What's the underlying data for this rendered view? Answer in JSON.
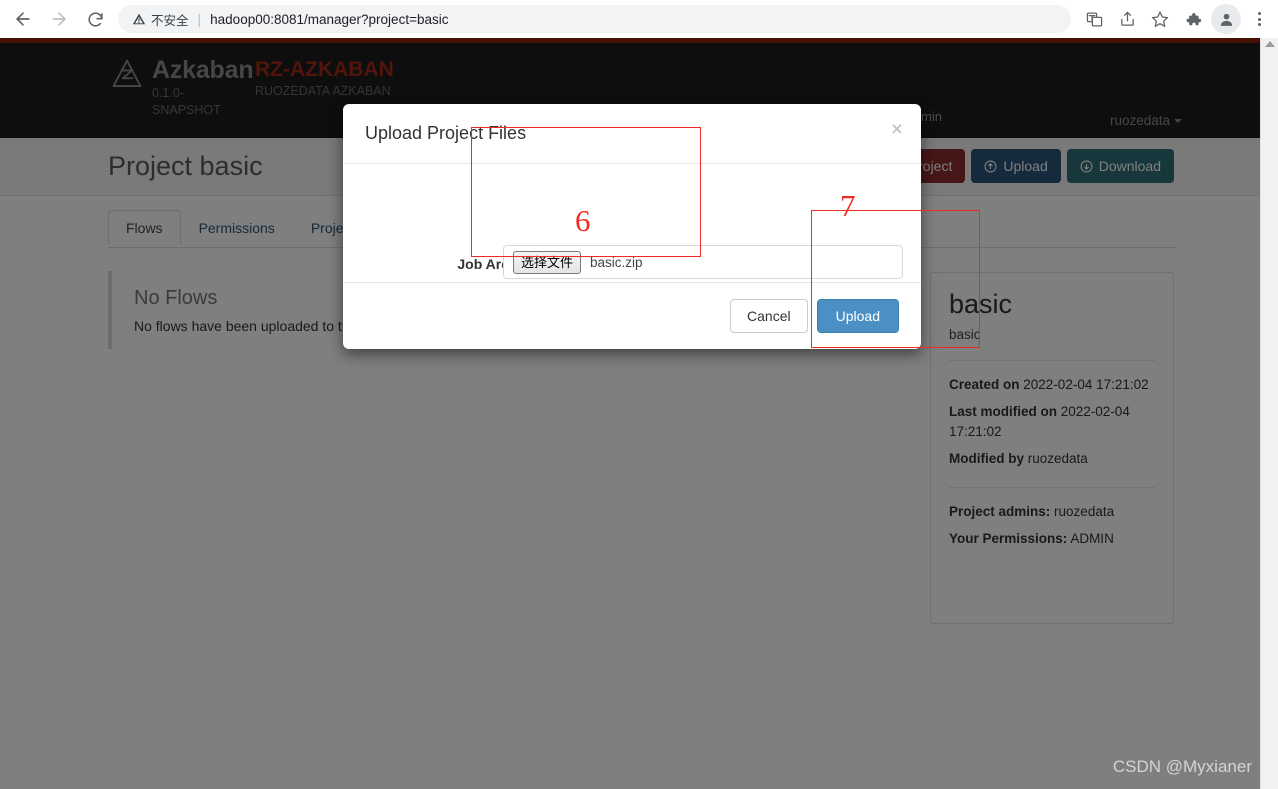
{
  "browser": {
    "back_icon": "arrow-left-icon",
    "forward_icon": "arrow-right-icon",
    "reload_icon": "reload-icon",
    "security_label": "不安全",
    "url": "hadoop00:8081/manager?project=basic",
    "translate_icon": "translate-icon",
    "share_icon": "share-icon",
    "bookmark_icon": "star-icon",
    "extensions_icon": "puzzle-icon",
    "profile_icon": "profile-avatar-icon",
    "menu_icon": "kebab-menu-icon"
  },
  "app_header": {
    "brand": "Azkaban",
    "version": "0.1.0-SNAPSHOT",
    "sub_title": "RZ-AZKABAN",
    "sub_desc": "RUOZEDATA AZKABAN",
    "nav_item": "Admin",
    "user": "ruozedata",
    "accent_red": "#a32b17",
    "bar_color": "#8c2309",
    "header_bg": "#1c1c1c"
  },
  "project": {
    "title": "Project basic",
    "actions": [
      {
        "label": "Delete Project",
        "icon": "trash-icon",
        "color": "#8f2c2c"
      },
      {
        "label": "Upload",
        "icon": "upload-circle-icon",
        "color": "#2a5578"
      },
      {
        "label": "Download",
        "icon": "download-circle-icon",
        "color": "#2e6e78"
      }
    ],
    "tabs": [
      {
        "label": "Flows",
        "active": true
      },
      {
        "label": "Permissions",
        "active": false
      },
      {
        "label": "Project Logs",
        "active": false
      }
    ],
    "empty_state": {
      "heading": "No Flows",
      "message": "No flows have been uploaded to this project yet."
    },
    "sidebar": {
      "name": "basic",
      "description": "basic",
      "created_on_label": "Created on",
      "created_on_value": "2022-02-04 17:21:02",
      "last_modified_label": "Last modified on",
      "last_modified_value": "2022-02-04 17:21:02",
      "modified_by_label": "Modified by",
      "modified_by_value": "ruozedata",
      "project_admins_label": "Project admins:",
      "project_admins_value": "ruozedata",
      "your_permissions_label": "Your Permissions:",
      "your_permissions_value": "ADMIN"
    }
  },
  "modal": {
    "title": "Upload Project Files",
    "close_label": "×",
    "field_label": "Job Archive",
    "choose_file_button": "选择文件",
    "file_name": "basic.zip",
    "cancel_label": "Cancel",
    "upload_label": "Upload",
    "upload_color": "#4a90c4"
  },
  "annotations": {
    "step_6": "6",
    "step_7": "7",
    "color": "#ee2b22"
  },
  "watermark": "CSDN @Myxianer"
}
